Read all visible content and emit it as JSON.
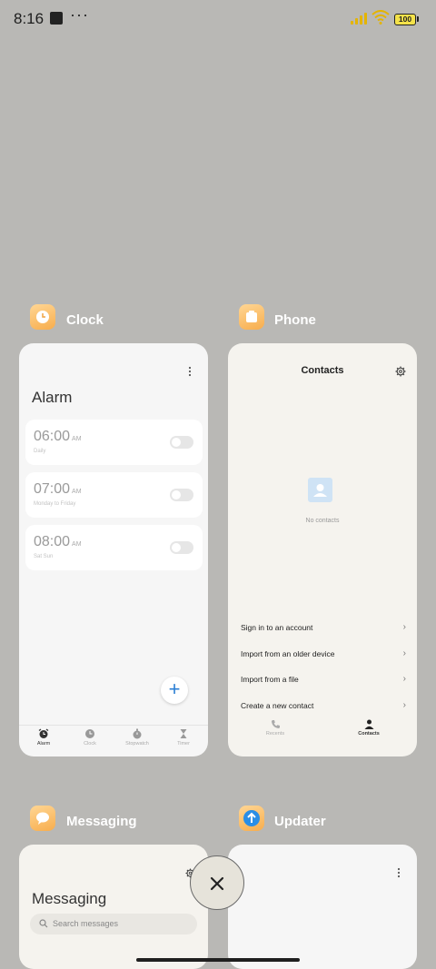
{
  "status_bar": {
    "time": "8:16",
    "battery": "100"
  },
  "recents": {
    "clock": {
      "app_name": "Clock",
      "title": "Alarm",
      "alarms": [
        {
          "time": "06:00",
          "ampm": "AM",
          "repeat": "Daily",
          "enabled": false
        },
        {
          "time": "07:00",
          "ampm": "AM",
          "repeat": "Monday to Friday",
          "enabled": false
        },
        {
          "time": "08:00",
          "ampm": "AM",
          "repeat": "Sat Sun",
          "enabled": false
        }
      ],
      "nav": [
        "Alarm",
        "Clock",
        "Stopwatch",
        "Timer"
      ]
    },
    "phone": {
      "app_name": "Phone",
      "title": "Contacts",
      "empty_text": "No contacts",
      "links": [
        "Sign in to an account",
        "Import from an older device",
        "Import from a file",
        "Create a new contact"
      ],
      "tabs": [
        "Recents",
        "Contacts"
      ]
    },
    "messaging": {
      "app_name": "Messaging",
      "title": "Messaging",
      "search_placeholder": "Search messages"
    },
    "updater": {
      "app_name": "Updater"
    }
  },
  "colors": {
    "background": "#b9b8b5",
    "accent": "#2a7ed4",
    "app_icon": "#f7ad4d"
  },
  "icons": {
    "close": "close-icon",
    "fab": "plus-icon"
  }
}
